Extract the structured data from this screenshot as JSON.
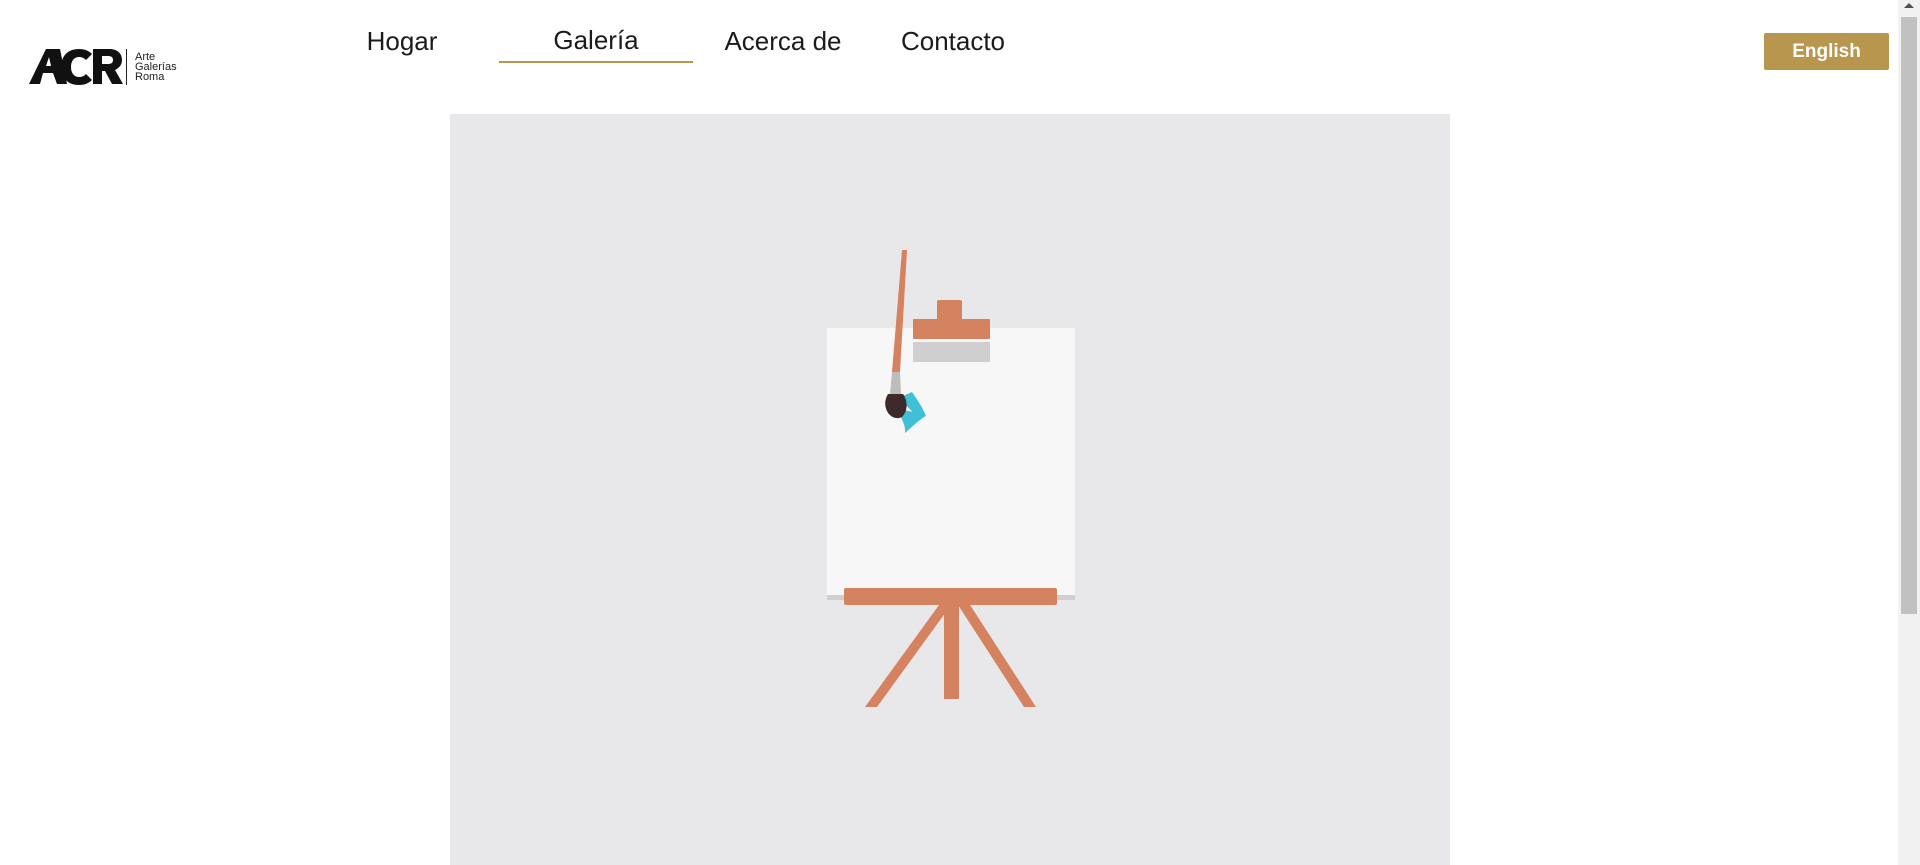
{
  "logo": {
    "mark": "ACR",
    "lines": [
      "Arte",
      "Galerías",
      "Roma"
    ]
  },
  "nav": {
    "items": [
      {
        "label": "Hogar",
        "active": false
      },
      {
        "label": "Galería",
        "active": true
      },
      {
        "label": "Acerca de",
        "active": false
      },
      {
        "label": "Contacto",
        "active": false
      }
    ]
  },
  "language_button": {
    "label": "English"
  },
  "colors": {
    "accent": "#b8964d",
    "hero_background": "#e8e8ea",
    "easel_wood": "#d4825f",
    "canvas": "#f7f7f7",
    "paint": "#3fc0d6"
  },
  "hero": {
    "illustration": "easel-with-paintbrush"
  }
}
